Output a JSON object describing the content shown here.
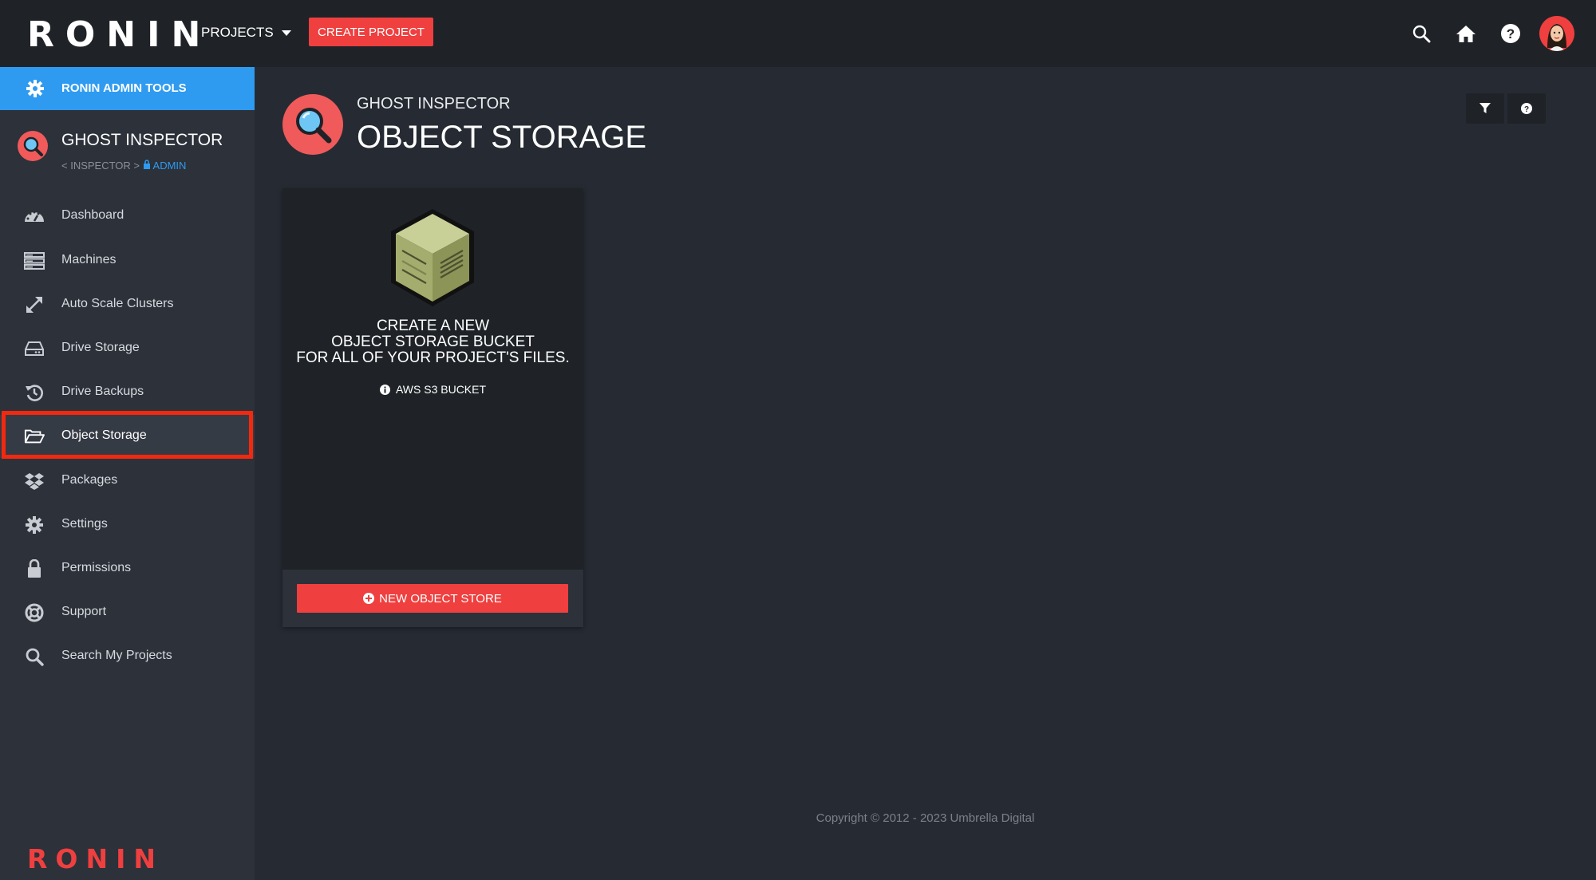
{
  "header": {
    "logo": "RONIN",
    "projects_label": "PROJECTS",
    "create_project_label": "CREATE PROJECT",
    "icons": [
      "search-icon",
      "home-icon",
      "help-icon",
      "avatar"
    ]
  },
  "sidebar": {
    "admin_tools_label": "RONIN ADMIN TOOLS",
    "project_name": "GHOST INSPECTOR",
    "breadcrumb_back": "< INSPECTOR >",
    "breadcrumb_admin": "ADMIN",
    "items": [
      {
        "label": "Dashboard",
        "icon": "dashboard-icon"
      },
      {
        "label": "Machines",
        "icon": "server-icon"
      },
      {
        "label": "Auto Scale Clusters",
        "icon": "expand-icon"
      },
      {
        "label": "Drive Storage",
        "icon": "drive-icon"
      },
      {
        "label": "Drive Backups",
        "icon": "history-icon"
      },
      {
        "label": "Object Storage",
        "icon": "folder-open-icon",
        "active": true
      },
      {
        "label": "Packages",
        "icon": "dropbox-icon"
      },
      {
        "label": "Settings",
        "icon": "gear-icon"
      },
      {
        "label": "Permissions",
        "icon": "lock-icon"
      },
      {
        "label": "Support",
        "icon": "lifebuoy-icon"
      },
      {
        "label": "Search My Projects",
        "icon": "search-icon"
      }
    ],
    "footer_logo": "RONIN"
  },
  "main": {
    "subtitle": "GHOST INSPECTOR",
    "title": "OBJECT STORAGE",
    "card": {
      "line1": "CREATE A NEW",
      "line2": "OBJECT STORAGE BUCKET",
      "line3": "FOR ALL OF YOUR PROJECT'S FILES.",
      "info": "AWS S3 BUCKET",
      "button_label": "NEW OBJECT STORE"
    }
  },
  "footer": {
    "copyright": "Copyright © 2012 - 2023 Umbrella Digital"
  },
  "colors": {
    "accent_red": "#ef3f3f",
    "accent_blue": "#2e9bf1",
    "topbar_bg": "#1f2328",
    "sidebar_bg": "#2c313a",
    "main_bg": "#262b33"
  }
}
